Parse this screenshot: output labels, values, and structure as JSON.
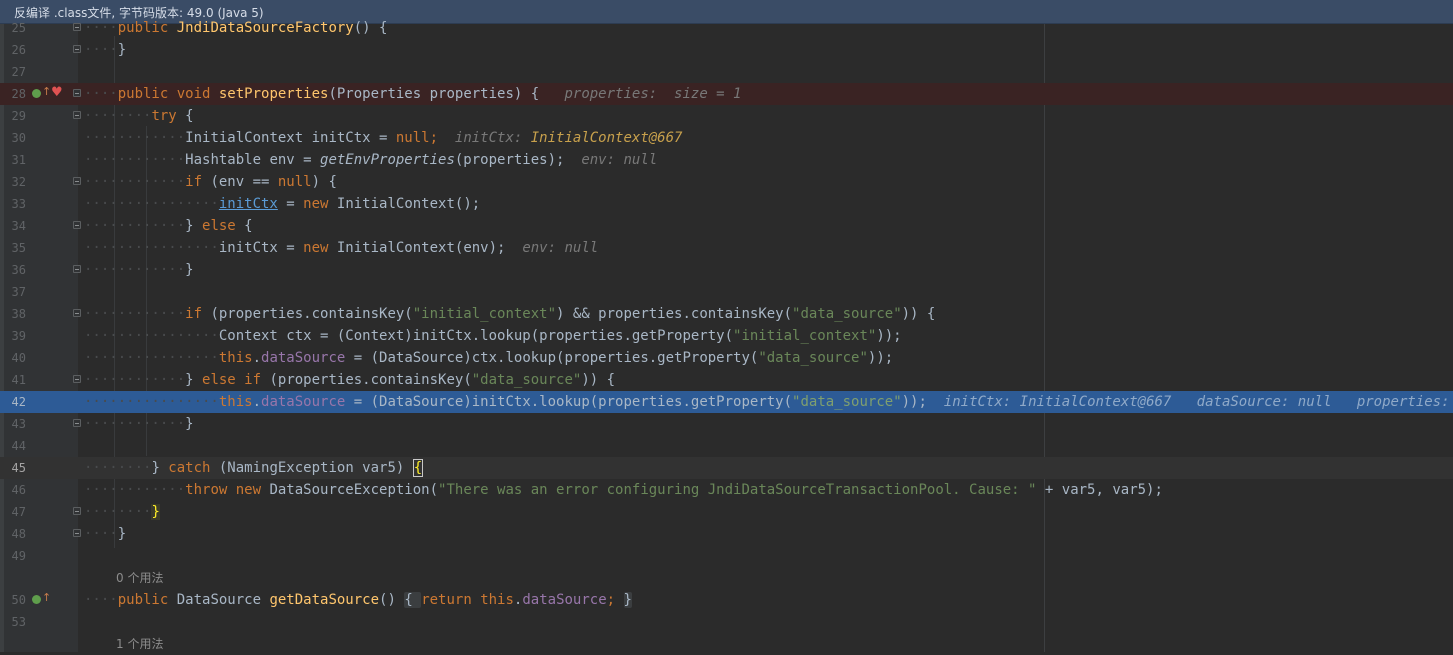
{
  "banner": {
    "text": "反编译 .class文件, 字节码版本: 49.0 (Java 5)"
  },
  "lines": {
    "l25": "25",
    "l26": "26",
    "l27": "27",
    "l28": "28",
    "l29": "29",
    "l30": "30",
    "l31": "31",
    "l32": "32",
    "l33": "33",
    "l34": "34",
    "l35": "35",
    "l36": "36",
    "l37": "37",
    "l38": "38",
    "l39": "39",
    "l40": "40",
    "l41": "41",
    "l42": "42",
    "l43": "43",
    "l44": "44",
    "l45": "45",
    "l46": "46",
    "l47": "47",
    "l48": "48",
    "l49": "49",
    "l50": "50",
    "l53": "53"
  },
  "usages": {
    "u1": "0 个用法",
    "u2": "1 个用法"
  },
  "code": {
    "l25_kw": "public",
    "l25_fn": "JndiDataSourceFactory",
    "l25_rest": "() {",
    "l26": "}",
    "l28_kw": "public void",
    "l28_fn": "setProperties",
    "l28_rest": "(Properties properties) {",
    "l28_hint": "properties:  size = 1",
    "l29_kw": "try",
    "l29_rest": " {",
    "l30_a": "InitialContext initCtx = ",
    "l30_kw": "null",
    "l30_b": ";",
    "l30_hint": "initCtx: ",
    "l30_obj": "InitialContext@667",
    "l31_a": "Hashtable env = ",
    "l31_it": "getEnvProperties",
    "l31_b": "(properties);",
    "l31_hint": "env: null",
    "l32_kw": "if",
    "l32_a": " (env == ",
    "l32_kw2": "null",
    "l32_b": ") {",
    "l33_lnk": "initCtx",
    "l33_a": " = ",
    "l33_kw": "new",
    "l33_b": " InitialContext();",
    "l34_a": "} ",
    "l34_kw": "else",
    "l34_b": " {",
    "l35_a": "initCtx = ",
    "l35_kw": "new",
    "l35_b": " InitialContext(env);",
    "l35_hint": "env: null",
    "l36": "}",
    "l38_kw": "if",
    "l38_a": " (properties.containsKey(",
    "l38_s1": "\"initial_context\"",
    "l38_b": ") && properties.containsKey(",
    "l38_s2": "\"data_source\"",
    "l38_c": ")) {",
    "l39_a": "Context ctx = (Context)initCtx.lookup(properties.getProperty(",
    "l39_s": "\"initial_context\"",
    "l39_b": "));",
    "l40_kw": "this",
    "l40_a": ".",
    "l40_f": "dataSource",
    "l40_b": " = (DataSource)ctx.lookup(properties.getProperty(",
    "l40_s": "\"data_source\"",
    "l40_c": "));",
    "l41_a": "} ",
    "l41_kw": "else if",
    "l41_b": " (properties.containsKey(",
    "l41_s": "\"data_source\"",
    "l41_c": ")) {",
    "l42_kw": "this",
    "l42_a": ".",
    "l42_f": "dataSource",
    "l42_b": " = (DataSource)initCtx.lookup(properties.getProperty(",
    "l42_s": "\"data_source\"",
    "l42_c": "));",
    "l42_h1": "initCtx: InitialContext@667",
    "l42_h2": "dataSource: null",
    "l42_h3": "properties:  size",
    "l43": "}",
    "l45_a": "} ",
    "l45_kw": "catch",
    "l45_b": " (NamingException var5) ",
    "l45_brace": "{",
    "l46_kw": "throw new",
    "l46_a": " DataSourceException(",
    "l46_s": "\"There was an error configuring JndiDataSourceTransactionPool. Cause: \"",
    "l46_b": " + var5, var5);",
    "l47_brace": "}",
    "l48": "}",
    "l50_kw": "public",
    "l50_a": " DataSource ",
    "l50_fn": "getDataSource",
    "l50_b": "() ",
    "l50_box1": "{ ",
    "l50_kw2": "return",
    "l50_sp": " ",
    "l50_kw3": "this",
    "l50_dot": ".",
    "l50_f": "dataSource",
    "l50_semi": "; ",
    "l50_box2": "}"
  }
}
